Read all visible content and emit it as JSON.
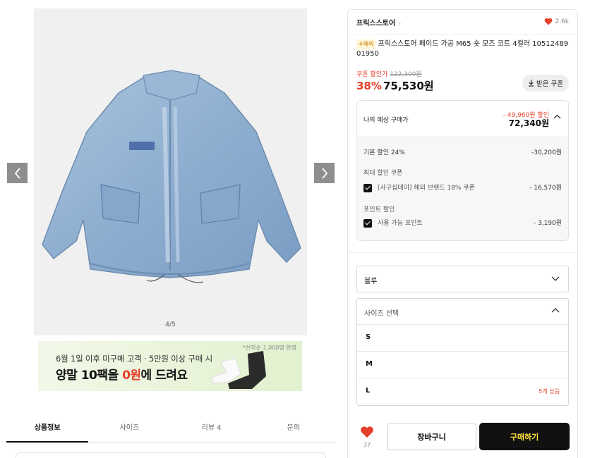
{
  "gallery": {
    "counter": "4/5",
    "prev_icon": "chevron-left-icon",
    "next_icon": "chevron-right-icon"
  },
  "banner": {
    "line1": "6월 1일 이후 미구매 고객 · 5만원 이상 구매 시",
    "line2_a": "양말 10팩을 ",
    "line2_b": "0원",
    "line2_c": "에 드려요",
    "note": "*선착순 1,000명 한정"
  },
  "tabs": [
    {
      "label": "상품정보"
    },
    {
      "label": "사이즈"
    },
    {
      "label": "리뷰 4"
    },
    {
      "label": "문의"
    }
  ],
  "product": {
    "store": "프릭스스토어",
    "likes": "2.6k",
    "badge": "✈해외",
    "title": "프릭스스토어 페이드 가공 M65 숏 모즈 코트 4컬러 1051248901950",
    "coupon_label": "쿠폰 할인가",
    "original_price": "122,300원",
    "discount_rate": "38%",
    "price": "75,530원",
    "coupon_button": "받은 쿠폰"
  },
  "estimate": {
    "label": "나의 예상 구매가",
    "discount_total": "- 49,960원 할인",
    "total": "72,340원",
    "base_label": "기본 할인 24%",
    "base_value": "-30,200원",
    "max_coupon_label": "최대 할인 쿠폰",
    "coupon_name": "[사구십데이] 해외 브랜드 18% 쿠폰",
    "coupon_value": "- 16,570원",
    "point_label": "포인트 할인",
    "point_name": "사용 가능 포인트",
    "point_value": "- 3,190원"
  },
  "options": {
    "color_value": "블루",
    "size_placeholder": "사이즈 선택",
    "sizes": [
      {
        "value": "S",
        "stock": ""
      },
      {
        "value": "M",
        "stock": ""
      },
      {
        "value": "L",
        "stock": "5개 남음"
      }
    ]
  },
  "actions": {
    "wish_count": "37",
    "cart": "장바구니",
    "buy": "구매하기"
  },
  "colors": {
    "accent_red": "#e5402b",
    "buy_bg": "#111111",
    "buy_text": "#ffe13a"
  }
}
